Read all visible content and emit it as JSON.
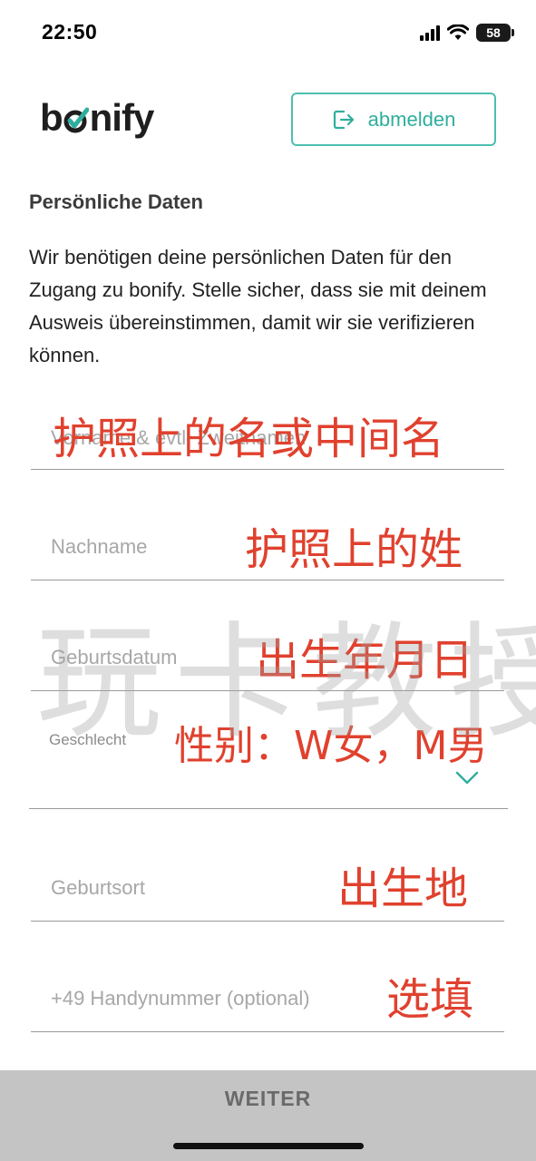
{
  "status_bar": {
    "time": "22:50",
    "battery": "58"
  },
  "header": {
    "logo_text": "bonify",
    "logout_label": "abmelden",
    "accent_color": "#2fae9d"
  },
  "section": {
    "title": "Persönliche Daten",
    "intro": "Wir benötigen deine persönlichen Daten für den Zugang zu bonify. Stelle sicher, dass sie mit deinem Ausweis übereinstimmen, damit wir sie verifizieren können."
  },
  "form": {
    "first_name_placeholder": "Vorname & evtl. Zweitnamen",
    "last_name_placeholder": "Nachname",
    "birthdate_placeholder": "Geburtsdatum",
    "gender_label": "Geschlecht",
    "birthplace_placeholder": "Geburtsort",
    "phone_placeholder": "+49 Handynummer (optional)"
  },
  "annotations": {
    "first_name": "护照上的名或中间名",
    "last_name": "护照上的姓",
    "birthdate": "出生年月日",
    "gender": "性别：W女，M男",
    "birthplace": "出生地",
    "phone": "选填",
    "color": "#e0412e"
  },
  "watermark": "玩卡教授",
  "footer": {
    "continue_label": "WEITER"
  }
}
